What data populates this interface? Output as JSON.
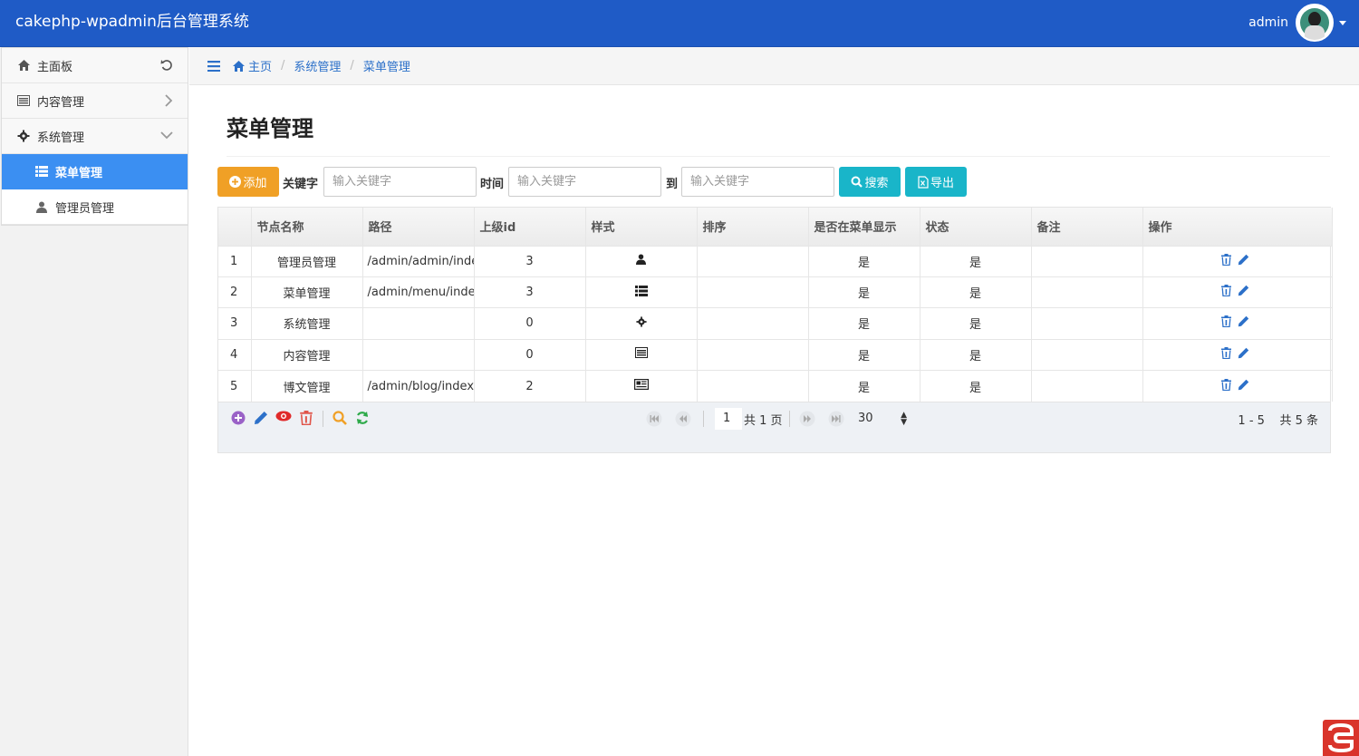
{
  "app": {
    "title": "cakephp-wpadmin后台管理系统",
    "user": "admin"
  },
  "sidebar": {
    "items": [
      {
        "label": "主面板",
        "icon": "home-icon",
        "right": "refresh-icon"
      },
      {
        "label": "内容管理",
        "icon": "list-alt-icon",
        "right": "chevron-right-icon"
      },
      {
        "label": "系统管理",
        "icon": "gear-icon",
        "right": "chevron-down-icon"
      },
      {
        "label": "菜单管理",
        "icon": "th-list-icon",
        "active": true
      },
      {
        "label": "管理员管理",
        "icon": "user-icon"
      }
    ]
  },
  "breadcrumb": {
    "home": "主页",
    "level1": "系统管理",
    "level2": "菜单管理"
  },
  "page": {
    "title": "菜单管理"
  },
  "toolbar": {
    "add_label": "添加",
    "keyword_label": "关键字",
    "keyword_placeholder": "输入关键字",
    "time_label": "时间",
    "time_from_placeholder": "输入关键字",
    "to_label": "到",
    "time_to_placeholder": "输入关键字",
    "search_label": "搜索",
    "export_label": "导出"
  },
  "table": {
    "headers": [
      "",
      "节点名称",
      "路径",
      "上级id",
      "样式",
      "排序",
      "是否在菜单显示",
      "状态",
      "备注",
      "操作"
    ],
    "rows": [
      {
        "num": "1",
        "name": "管理员管理",
        "path": "/admin/admin/index",
        "parent": "3",
        "style": "user-icon",
        "sort": "",
        "show": "是",
        "status": "是",
        "note": ""
      },
      {
        "num": "2",
        "name": "菜单管理",
        "path": "/admin/menu/index",
        "parent": "3",
        "style": "th-list-icon",
        "sort": "",
        "show": "是",
        "status": "是",
        "note": ""
      },
      {
        "num": "3",
        "name": "系统管理",
        "path": "",
        "parent": "0",
        "style": "gear-icon",
        "sort": "",
        "show": "是",
        "status": "是",
        "note": ""
      },
      {
        "num": "4",
        "name": "内容管理",
        "path": "",
        "parent": "0",
        "style": "list-alt-icon",
        "sort": "",
        "show": "是",
        "status": "是",
        "note": ""
      },
      {
        "num": "5",
        "name": "博文管理",
        "path": "/admin/blog/index",
        "parent": "2",
        "style": "newspaper-icon",
        "sort": "",
        "show": "是",
        "status": "是",
        "note": ""
      }
    ]
  },
  "pager": {
    "page": "1",
    "total_pages": "共 1 页",
    "page_size": "30",
    "range": "1 - 5    共 5 条"
  },
  "colors": {
    "navbar": "#1f5bc6",
    "active": "#3b8ff2",
    "add": "#f0a026",
    "teal": "#19b5c9",
    "link": "#2c70c9"
  }
}
